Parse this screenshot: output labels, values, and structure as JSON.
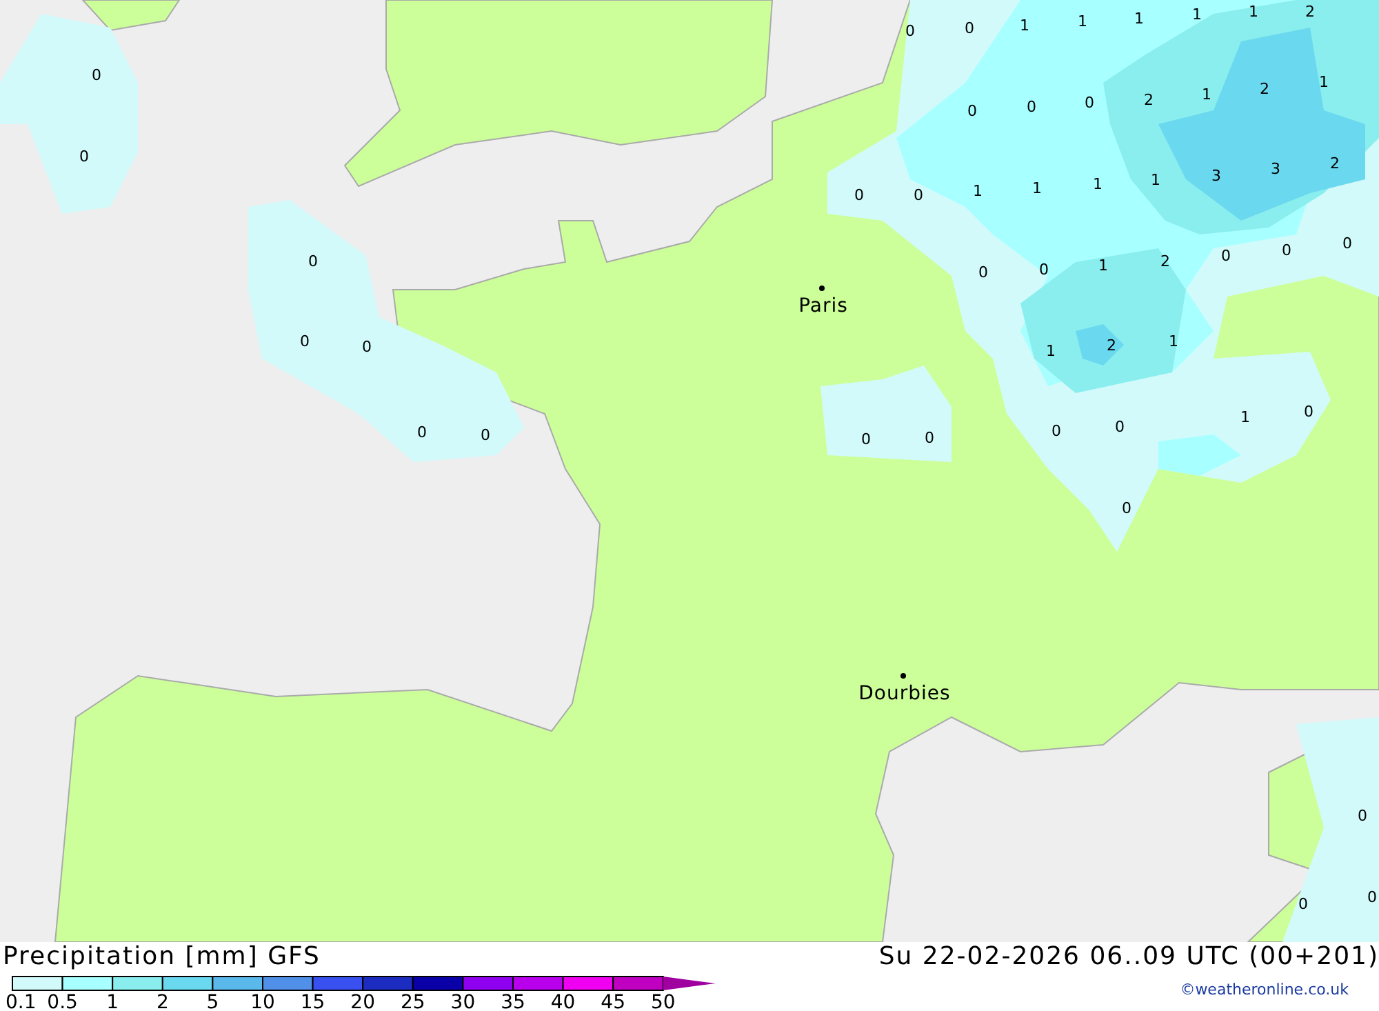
{
  "map": {
    "cities": [
      {
        "name": "Paris"
      },
      {
        "name": "Dourbies"
      }
    ],
    "value_labels": [
      "0",
      "0",
      "1",
      "1",
      "1",
      "1",
      "1",
      "2",
      "0",
      "0",
      "0",
      "0",
      "0",
      "2",
      "1",
      "2",
      "1",
      "0",
      "0",
      "1",
      "1",
      "1",
      "1",
      "3",
      "3",
      "2",
      "0",
      "0",
      "1",
      "2",
      "0",
      "0",
      "0",
      "0",
      "0",
      "0",
      "1",
      "2",
      "1",
      "0",
      "0",
      "0",
      "0",
      "0",
      "0",
      "1",
      "0",
      "0",
      "0",
      "0",
      "0"
    ]
  },
  "legend": {
    "title": "Precipitation [mm] GFS",
    "max_label": "50",
    "scale": [
      {
        "label": "0.1",
        "color": "#d2fafa"
      },
      {
        "label": "0.5",
        "color": "#a8ffff"
      },
      {
        "label": "1",
        "color": "#8aeeee"
      },
      {
        "label": "2",
        "color": "#6ad8ee"
      },
      {
        "label": "5",
        "color": "#5ab8ea"
      },
      {
        "label": "10",
        "color": "#5090e8"
      },
      {
        "label": "15",
        "color": "#3850f0"
      },
      {
        "label": "20",
        "color": "#1c2cc0"
      },
      {
        "label": "25",
        "color": "#0a00a8"
      },
      {
        "label": "30",
        "color": "#9000f0"
      },
      {
        "label": "35",
        "color": "#b800ec"
      },
      {
        "label": "40",
        "color": "#f000f0"
      },
      {
        "label": "45",
        "color": "#c000c0"
      }
    ]
  },
  "valid_time": "Su 22-02-2026 06..09 UTC (00+201)",
  "credit": "©weatheronline.co.uk"
}
